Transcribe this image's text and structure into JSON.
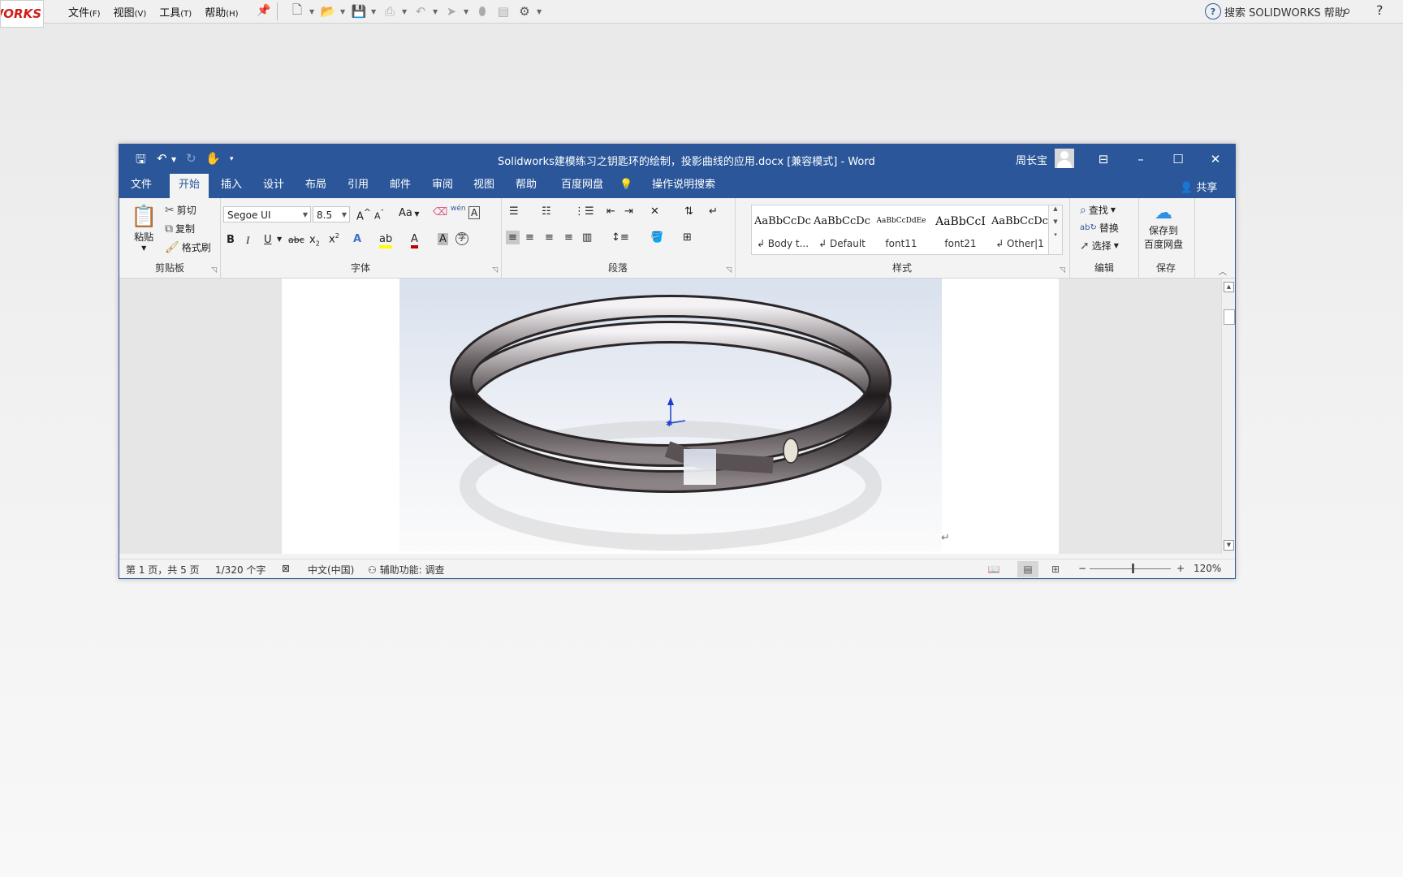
{
  "solidworks": {
    "logo": "WORKS",
    "menu": [
      {
        "label": "文件",
        "key": "(F)"
      },
      {
        "label": "视图",
        "key": "(V)"
      },
      {
        "label": "工具",
        "key": "(T)"
      },
      {
        "label": "帮助",
        "key": "(H)"
      }
    ],
    "search_label": "搜索 SOLIDWORKS 帮助",
    "help": "?"
  },
  "word": {
    "title": "Solidworks建模练习之钥匙环的绘制，投影曲线的应用.docx [兼容模式]  -  Word",
    "user": "周长宝",
    "tabs": [
      "文件",
      "开始",
      "插入",
      "设计",
      "布局",
      "引用",
      "邮件",
      "审阅",
      "视图",
      "帮助",
      "百度网盘",
      "操作说明搜索"
    ],
    "active_tab": "开始",
    "share": "共享",
    "ribbon": {
      "clipboard": {
        "label": "剪贴板",
        "paste": "粘贴",
        "cut": "剪切",
        "copy": "复制",
        "format_painter": "格式刷"
      },
      "font": {
        "label": "字体",
        "font_name": "Segoe UI",
        "font_size": "8.5",
        "case": "Aa",
        "pinyin": "wén"
      },
      "paragraph": {
        "label": "段落"
      },
      "styles": {
        "label": "样式",
        "items": [
          {
            "sample": "AaBbCcDc",
            "name": "↲ Body t..."
          },
          {
            "sample": "AaBbCcDc",
            "name": "↲ Default"
          },
          {
            "sample": "AaBbCcDdEe",
            "name": "font11"
          },
          {
            "sample": "AaBbCcI",
            "name": "font21"
          },
          {
            "sample": "AaBbCcDc",
            "name": "↲ Other|1"
          }
        ]
      },
      "editing": {
        "label": "编辑",
        "find": "查找",
        "replace": "替换",
        "select": "选择"
      },
      "save": {
        "label": "保存",
        "button": "保存到",
        "button2": "百度网盘"
      }
    },
    "status": {
      "page": "第 1 页，共 5 页",
      "words": "1/320 个字",
      "language": "中文(中国)",
      "accessibility": "辅助功能: 调查",
      "zoom": "120%",
      "zoom_minus": "−",
      "zoom_plus": "+"
    },
    "colors": {
      "accent": "#2b579a",
      "highlight": "#ffff00",
      "font_color": "#c00000"
    }
  }
}
